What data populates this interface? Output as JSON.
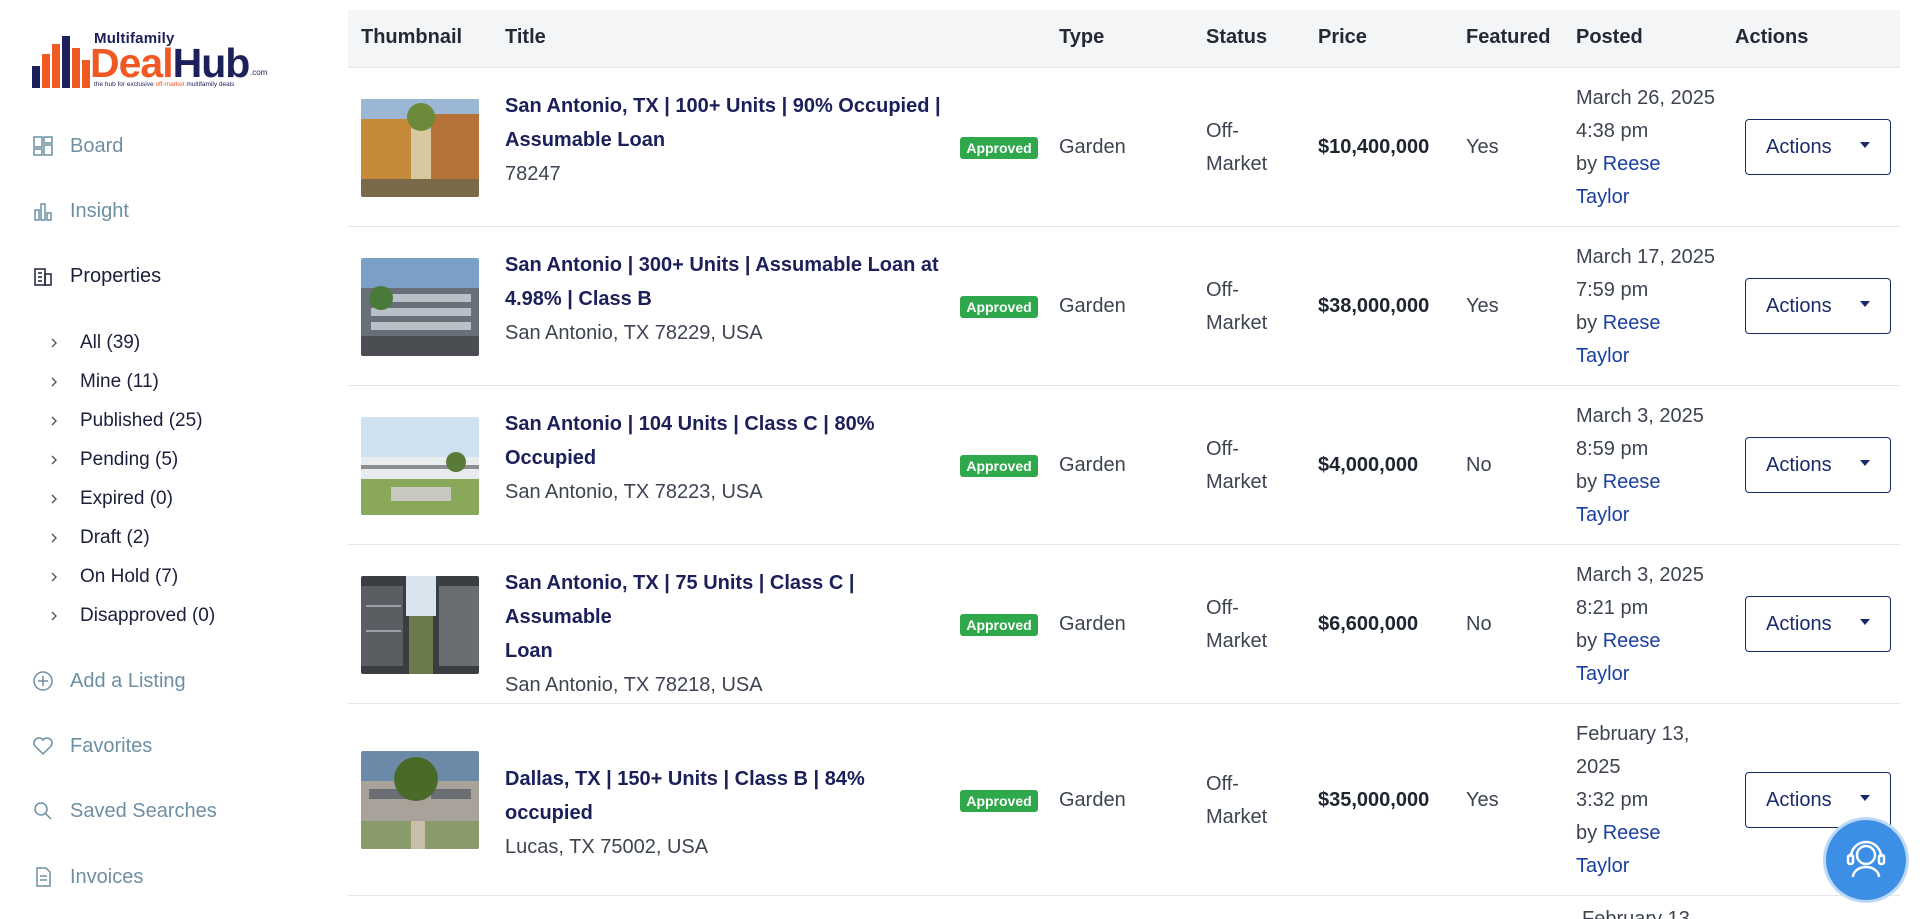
{
  "logo": {
    "super_text": "Multifamily",
    "brand_deal": "Deal",
    "brand_hub": "Hub",
    "dot_com": ".com",
    "tagline_pre": "the hub for exclusive ",
    "tagline_mid": "off-market",
    "tagline_post": " multifamily deals"
  },
  "sidebar": {
    "board": "Board",
    "insight": "Insight",
    "properties": "Properties",
    "filters": [
      "All (39)",
      "Mine (11)",
      "Published (25)",
      "Pending (5)",
      "Expired (0)",
      "Draft (2)",
      "On Hold (7)",
      "Disapproved (0)"
    ],
    "add_listing": "Add a Listing",
    "favorites": "Favorites",
    "saved_searches": "Saved Searches",
    "invoices": "Invoices"
  },
  "table": {
    "headers": {
      "thumbnail": "Thumbnail",
      "title": "Title",
      "type": "Type",
      "status": "Status",
      "price": "Price",
      "featured": "Featured",
      "posted": "Posted",
      "actions": "Actions"
    },
    "rows": [
      {
        "title_l1": "San Antonio, TX | 100+ Units | 90% Occupied |",
        "title_l2": "Assumable Loan",
        "address": "78247",
        "badge": "Approved",
        "type": "Garden",
        "status_l1": "Off-",
        "status_l2": "Market",
        "price": "$10,400,000",
        "featured": "Yes",
        "posted_l1": "March 26, 2025",
        "posted_l2": "4:38 pm",
        "by": "by ",
        "author_first": "Reese",
        "author_last": "Taylor",
        "action": "Actions"
      },
      {
        "title_l1": "San Antonio | 300+ Units | Assumable Loan at",
        "title_l2": "4.98% | Class B",
        "address": "San Antonio, TX 78229, USA",
        "badge": "Approved",
        "type": "Garden",
        "status_l1": "Off-",
        "status_l2": "Market",
        "price": "$38,000,000",
        "featured": "Yes",
        "posted_l1": "March 17, 2025",
        "posted_l2": "7:59 pm",
        "by": "by ",
        "author_first": "Reese",
        "author_last": "Taylor",
        "action": "Actions"
      },
      {
        "title_l1": "San Antonio | 104 Units | Class C | 80%",
        "title_l2": "Occupied",
        "address": "San Antonio, TX 78223, USA",
        "badge": "Approved",
        "type": "Garden",
        "status_l1": "Off-",
        "status_l2": "Market",
        "price": "$4,000,000",
        "featured": "No",
        "posted_l1": "March 3, 2025",
        "posted_l2": "8:59 pm",
        "by": "by ",
        "author_first": "Reese",
        "author_last": "Taylor",
        "action": "Actions"
      },
      {
        "title_l1": "San Antonio, TX | 75 Units | Class C | Assumable",
        "title_l2": "Loan",
        "address": "San Antonio, TX 78218, USA",
        "badge": "Approved",
        "type": "Garden",
        "status_l1": "Off-",
        "status_l2": "Market",
        "price": "$6,600,000",
        "featured": "No",
        "posted_l1": "March 3, 2025",
        "posted_l2": "8:21 pm",
        "by": "by ",
        "author_first": "Reese",
        "author_last": "Taylor",
        "action": "Actions"
      },
      {
        "title_l1": "Dallas, TX | 150+ Units | Class B | 84% occupied",
        "address": "Lucas, TX 75002, USA",
        "badge": "Approved",
        "type": "Garden",
        "status_l1": "Off-",
        "status_l2": "Market",
        "price": "$35,000,000",
        "featured": "Yes",
        "posted_l1": "February 13,",
        "posted_l1b": "2025",
        "posted_l2": "3:32 pm",
        "by": "by ",
        "author_first": "Reese",
        "author_last": "Taylor",
        "action": "Actions"
      }
    ],
    "next_row_peek": "February 13"
  },
  "colors": {
    "brand_navy": "#1b1f5a",
    "brand_orange": "#ef5a24",
    "approved_green": "#2ea84a",
    "nav_muted": "#6d8fa3",
    "support_blue": "#3d8fe6"
  },
  "icons": {
    "board": "board-icon",
    "insight": "bar-chart-icon",
    "properties": "building-icon",
    "add_listing": "plus-circle-icon",
    "favorites": "heart-icon",
    "saved_searches": "search-icon",
    "invoices": "invoice-icon",
    "support": "support-agent-icon"
  }
}
